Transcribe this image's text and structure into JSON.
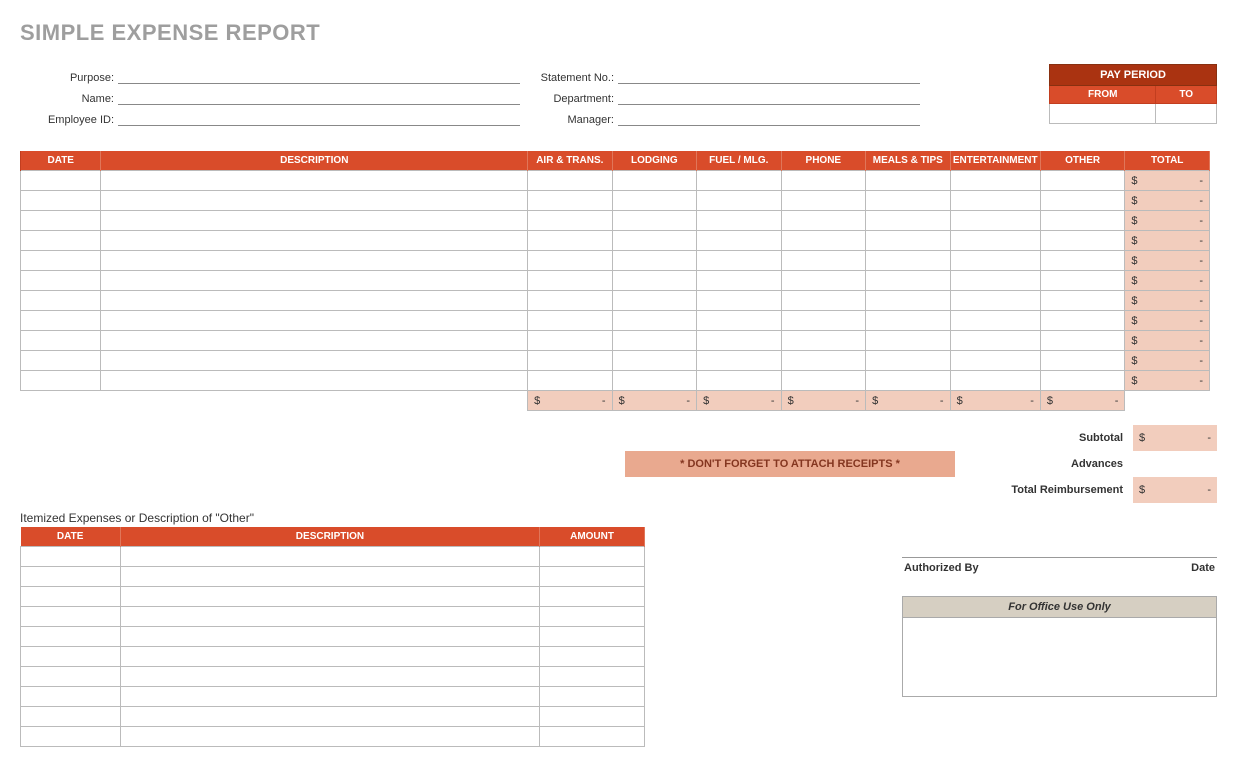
{
  "title": "SIMPLE EXPENSE REPORT",
  "fields": {
    "purpose": "Purpose:",
    "name": "Name:",
    "employee_id": "Employee ID:",
    "statement_no": "Statement No.:",
    "department": "Department:",
    "manager": "Manager:"
  },
  "pay_period": {
    "title": "PAY PERIOD",
    "from": "FROM",
    "to": "TO"
  },
  "main_headers": {
    "date": "DATE",
    "description": "DESCRIPTION",
    "air": "AIR & TRANS.",
    "lodging": "LODGING",
    "fuel": "FUEL / MLG.",
    "phone": "PHONE",
    "meals": "MEALS & TIPS",
    "entertainment": "ENTERTAINMENT",
    "other": "OTHER",
    "total": "TOTAL"
  },
  "currency": "$",
  "dash": "-",
  "receipts_note": "* DON'T FORGET TO ATTACH RECEIPTS *",
  "summary": {
    "subtotal": "Subtotal",
    "advances": "Advances",
    "total_reimbursement": "Total Reimbursement"
  },
  "itemized_label": "Itemized Expenses or Description of \"Other\"",
  "itemized_headers": {
    "date": "DATE",
    "description": "DESCRIPTION",
    "amount": "AMOUNT"
  },
  "auth": {
    "by": "Authorized By",
    "date": "Date"
  },
  "office_use": "For Office Use Only"
}
